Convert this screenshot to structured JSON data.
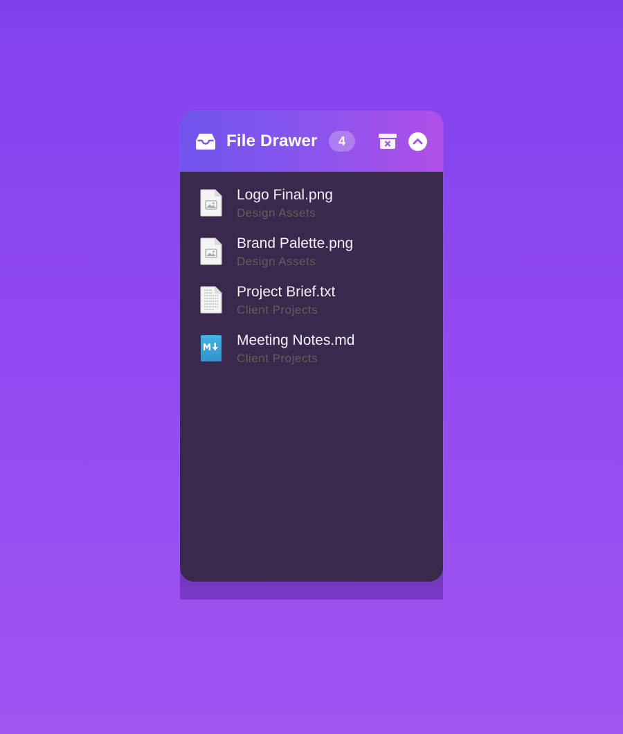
{
  "drawer": {
    "title": "File Drawer",
    "count": "4",
    "icons": {
      "header": "inbox-tray-icon",
      "clear": "archive-clear-icon",
      "collapse": "chevron-up-icon"
    },
    "files": [
      {
        "name": "Logo Final.png",
        "folder": "Design Assets",
        "icon": "image-file-icon"
      },
      {
        "name": "Brand Palette.png",
        "folder": "Design Assets",
        "icon": "image-file-icon"
      },
      {
        "name": "Project Brief.txt",
        "folder": "Client Projects",
        "icon": "text-file-icon"
      },
      {
        "name": "Meeting Notes.md",
        "folder": "Client Projects",
        "icon": "markdown-file-icon"
      }
    ]
  },
  "colors": {
    "background_top": "#8041ed",
    "background_bottom": "#a154f2",
    "header_gradient_start": "#6f55ec",
    "header_gradient_end": "#b04fe8",
    "panel": "#38294d",
    "file_name": "#f3f0f8",
    "folder_label": "#5f6257",
    "markdown_badge": "#3aa6d6"
  }
}
